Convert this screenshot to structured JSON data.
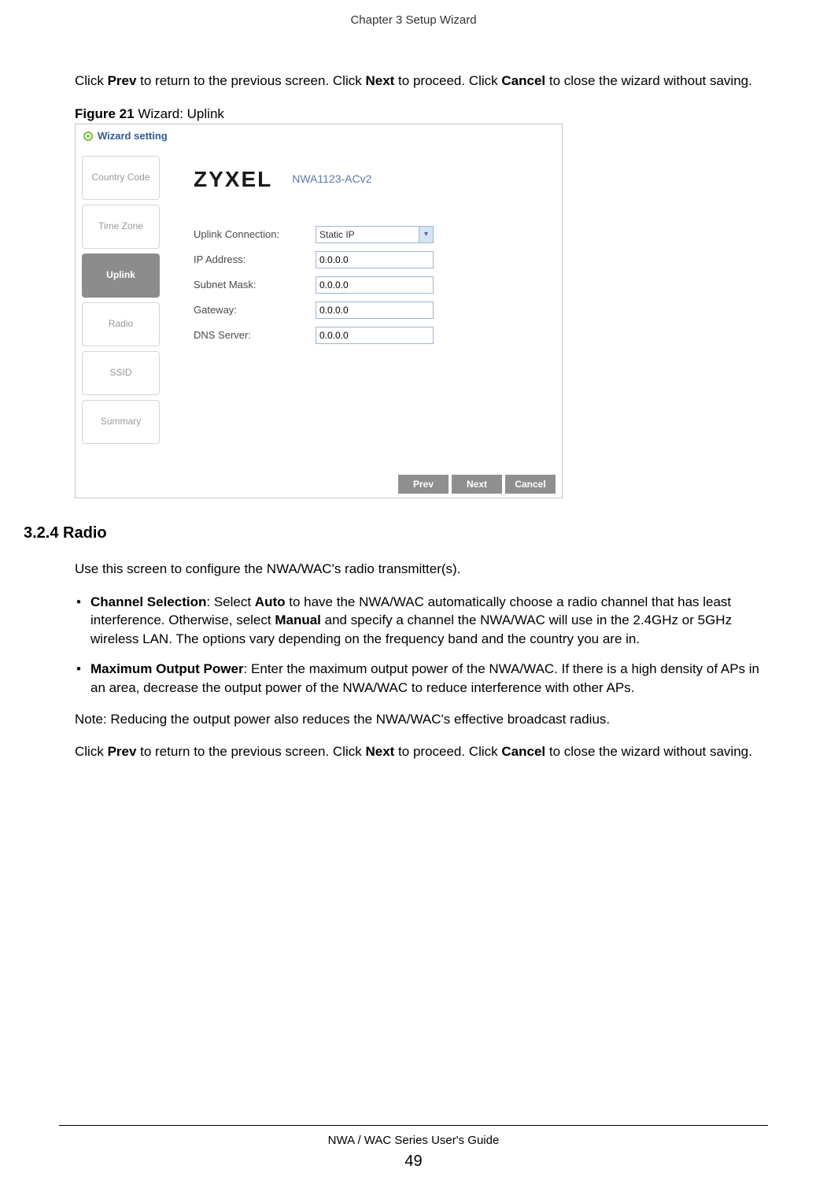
{
  "page_header": "Chapter 3 Setup Wizard",
  "intro_para": {
    "click": "Click ",
    "prev_b": "Prev",
    "text1": " to return to the previous screen. Click ",
    "next_b": "Next",
    "text2": " to proceed. Click ",
    "cancel_b": "Cancel",
    "text3": " to close the wizard without saving."
  },
  "figure_label_prefix": "Figure 21",
  "figure_label_rest": "   Wizard: Uplink",
  "wizard": {
    "title": "Wizard setting",
    "steps": [
      "Country Code",
      "Time Zone",
      "Uplink",
      "Radio",
      "SSID",
      "Summary"
    ],
    "active_step_index": 2,
    "brand": "ZYXEL",
    "model": "NWA1123-ACv2",
    "fields": [
      {
        "label": "Uplink Connection:",
        "type": "select",
        "value": "Static IP"
      },
      {
        "label": "IP Address:",
        "type": "input",
        "value": "0.0.0.0"
      },
      {
        "label": "Subnet Mask:",
        "type": "input",
        "value": "0.0.0.0"
      },
      {
        "label": "Gateway:",
        "type": "input",
        "value": "0.0.0.0"
      },
      {
        "label": "DNS Server:",
        "type": "input",
        "value": "0.0.0.0"
      }
    ],
    "buttons": {
      "prev": "Prev",
      "next": "Next",
      "cancel": "Cancel"
    }
  },
  "section_heading": "3.2.4  Radio",
  "radio_intro": "Use this screen to configure the NWA/WAC's radio transmitter(s).",
  "bullets": [
    {
      "b": "Channel Selection",
      "colon": ": Select ",
      "b2": "Auto",
      "text1": " to have the NWA/WAC automatically choose a radio channel that has least interference. Otherwise, select ",
      "b3": "Manual",
      "text2": " and specify a channel the NWA/WAC will use in the 2.4GHz or 5GHz wireless LAN. The options vary depending on the frequency band and the country you are in."
    },
    {
      "b": "Maximum Output Power",
      "colon": ": Enter the maximum output power of the NWA/WAC. If there is a high density of APs in an area, decrease the output power of the NWA/WAC to reduce interference with other APs.",
      "b2": "",
      "text1": "",
      "b3": "",
      "text2": ""
    }
  ],
  "note": "Note: Reducing the output power also reduces the NWA/WAC's effective broadcast radius.",
  "outro_para": {
    "click": "Click ",
    "prev_b": "Prev",
    "text1": " to return to the previous screen. Click ",
    "next_b": "Next",
    "text2": " to proceed. Click ",
    "cancel_b": "Cancel",
    "text3": " to close the wizard without saving."
  },
  "footer_text": "NWA / WAC Series User's Guide",
  "page_number": "49"
}
